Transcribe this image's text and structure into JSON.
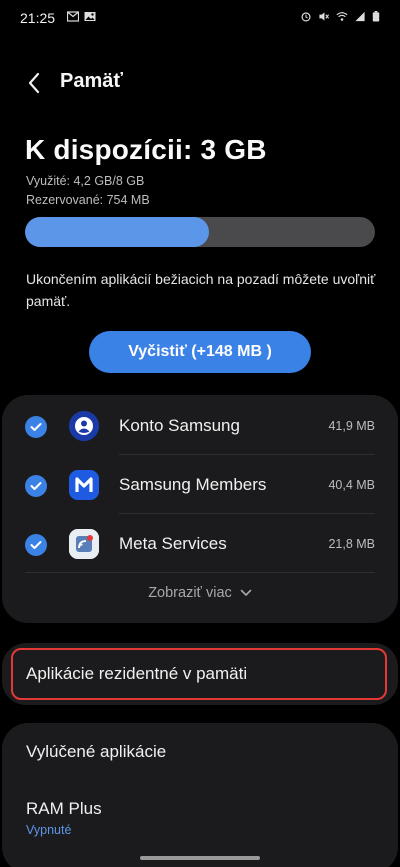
{
  "status_bar": {
    "time": "21:25",
    "left_icons": [
      "gmail-icon",
      "gallery-icon"
    ],
    "right_icons": [
      "alarm-icon",
      "mute-icon",
      "wifi-calling-icon",
      "signal-icon",
      "battery-icon"
    ]
  },
  "header": {
    "title": "Pamäť"
  },
  "memory": {
    "available": "K dispozícii: 3 GB",
    "used": "Využité: 4,2 GB/8 GB",
    "reserved": "Rezervované: 754 MB",
    "used_fraction": 0.525
  },
  "info_text": "Ukončením aplikácií bežiacich na pozadí môžete uvoľniť pamäť.",
  "clean_button": "Vyčistiť (+148 MB )",
  "apps": [
    {
      "name": "Konto Samsung",
      "size": "41,9 MB",
      "checked": true,
      "icon": "samsung-account-icon"
    },
    {
      "name": "Samsung Members",
      "size": "40,4 MB",
      "checked": true,
      "icon": "samsung-members-icon"
    },
    {
      "name": "Meta Services",
      "size": "21,8 MB",
      "checked": true,
      "icon": "meta-services-icon"
    }
  ],
  "show_more": "Zobraziť viac",
  "resident_apps": "Aplikácie rezidentné v pamäti",
  "excluded_apps": "Vylúčené aplikácie",
  "ram_plus": {
    "label": "RAM Plus",
    "status": "Vypnuté"
  },
  "colors": {
    "accent": "#3b82e6",
    "bar_fill": "#5c96e8",
    "highlight": "#e53935",
    "card": "#1b1b1d"
  }
}
